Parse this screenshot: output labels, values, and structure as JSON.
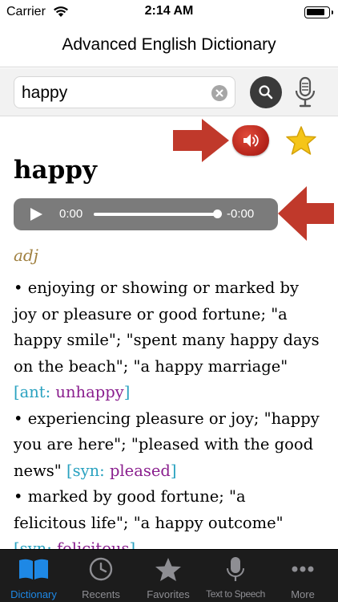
{
  "status_bar": {
    "carrier": "Carrier",
    "time": "2:14 AM"
  },
  "nav": {
    "title": "Advanced English Dictionary"
  },
  "search": {
    "value": "happy",
    "placeholder": ""
  },
  "entry": {
    "headword": "happy",
    "audio": {
      "elapsed": "0:00",
      "remaining": "-0:00",
      "progress": 1.0
    },
    "part_of_speech": "adj",
    "definitions": [
      {
        "text": "• enjoying or showing or marked by joy or pleasure or good fortune; \"a happy smile\"; \"spent many happy days on the beach\"; \"a happy marriage\" ",
        "rel_open": "[ant: ",
        "rel_word": "unhappy",
        "rel_close": "]"
      },
      {
        "text": "• experiencing pleasure or joy; \"happy you are here\"; \"pleased with the good news\" ",
        "rel_open": "[syn: ",
        "rel_word": "pleased",
        "rel_close": "]"
      },
      {
        "text": "• marked by good fortune; \"a felicitous life\"; \"a happy outcome\" ",
        "rel_open": "[syn: ",
        "rel_word": "felicitous",
        "rel_close": "]"
      }
    ]
  },
  "tabs": [
    {
      "label": "Dictionary",
      "icon": "book-icon",
      "active": true
    },
    {
      "label": "Recents",
      "icon": "clock-icon",
      "active": false
    },
    {
      "label": "Favorites",
      "icon": "star-icon",
      "active": false
    },
    {
      "label": "Text to Speech",
      "icon": "microphone-icon",
      "active": false
    },
    {
      "label": "More",
      "icon": "more-icon",
      "active": false
    }
  ],
  "colors": {
    "accent_blue": "#1e88e5",
    "arrow_red": "#c0392b",
    "pos_gold": "#a08040",
    "bracket_teal": "#2aa2c0",
    "related_purple": "#8a1f8e",
    "tab_bar_bg": "#1c1c1c"
  }
}
